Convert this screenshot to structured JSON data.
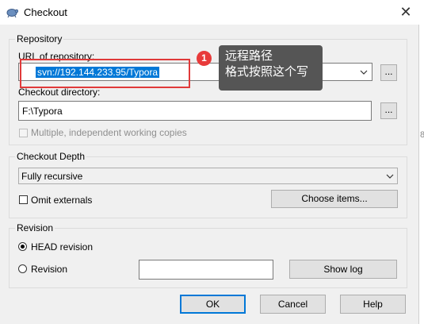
{
  "window": {
    "title": "Checkout"
  },
  "repository": {
    "legend": "Repository",
    "url_label": "URL of repository:",
    "url_value": "svn://192.144.233.95/Typora",
    "browse_label": "...",
    "checkout_dir_label": "Checkout directory:",
    "checkout_dir_value": "F:\\Typora",
    "multiple_copies_label": "Multiple, independent working copies"
  },
  "depth": {
    "legend": "Checkout Depth",
    "selected": "Fully recursive",
    "omit_externals_label": "Omit externals",
    "choose_items_label": "Choose items..."
  },
  "revision": {
    "legend": "Revision",
    "head_label": "HEAD revision",
    "revision_label": "Revision",
    "revision_value": "",
    "show_log_label": "Show log"
  },
  "buttons": {
    "ok": "OK",
    "cancel": "Cancel",
    "help": "Help"
  },
  "annotation": {
    "badge": "1",
    "line1": "远程路径",
    "line2": "格式按照这个写"
  },
  "edge_text": "8",
  "colors": {
    "accent": "#0078d7",
    "highlight_box": "#e03a3a",
    "tooltip_bg": "#555555"
  }
}
